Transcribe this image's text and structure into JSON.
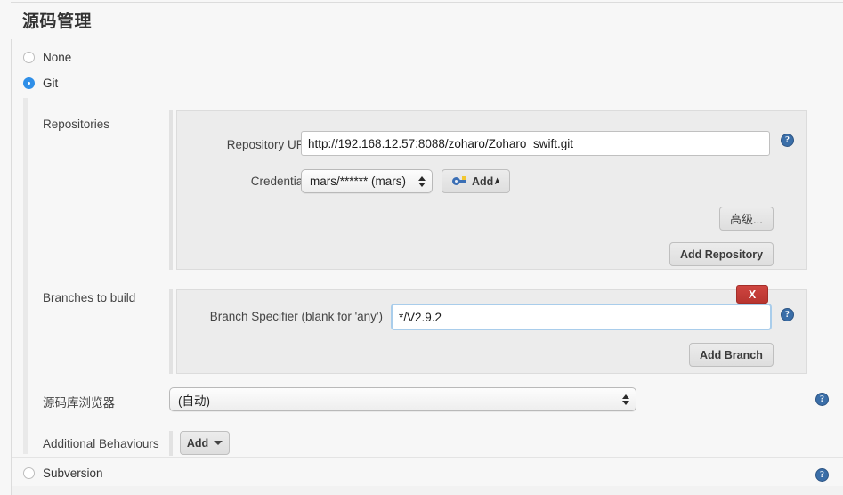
{
  "page": {
    "section_title": "源码管理"
  },
  "scm_options": [
    {
      "label": "None",
      "checked": false
    },
    {
      "label": "Git",
      "checked": true
    },
    {
      "label": "Subversion",
      "checked": false
    }
  ],
  "git": {
    "repositories": {
      "row_label": "Repositories",
      "repository_url": {
        "label": "Repository URL",
        "value": "http://192.168.12.57:8088/zoharo/Zoharo_swift.git",
        "placeholder": ""
      },
      "credentials": {
        "label": "Credentials",
        "selected": "mars/****** (mars)",
        "add_button": "Add",
        "add_icon": "key-icon"
      },
      "advanced_button": "高级...",
      "add_repository_button": "Add Repository"
    },
    "branches": {
      "row_label": "Branches to build",
      "branch_specifier": {
        "label": "Branch Specifier (blank for 'any')",
        "value": "*/V2.9.2",
        "placeholder": ""
      },
      "delete_button": "X",
      "add_branch_button": "Add Branch"
    },
    "repository_browser": {
      "row_label": "源码库浏览器",
      "selected": "(自动)"
    },
    "additional_behaviours": {
      "row_label": "Additional Behaviours",
      "add_button": "Add"
    }
  },
  "help_icon_glyph": "?",
  "colors": {
    "accent_blue": "#2f8fe8",
    "help_blue": "#3a6ea8",
    "danger_red": "#c33f39",
    "panel_bg": "#ececec",
    "page_bg": "#f7f7f7"
  }
}
